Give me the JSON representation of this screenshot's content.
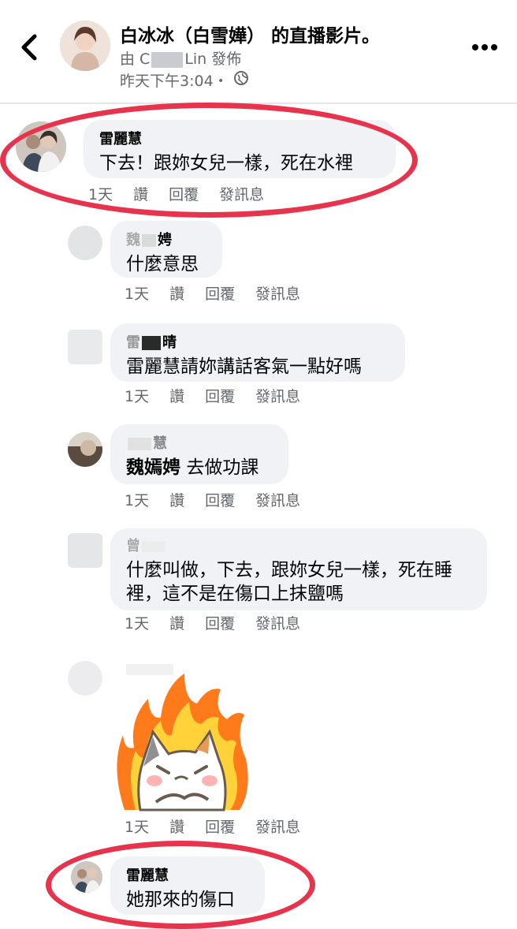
{
  "header": {
    "back_icon": "chevron-left-icon",
    "title": "白冰冰（白雪嬅） 的直播影片。",
    "by_prefix": "由 C",
    "by_suffix": "Lin 發佈",
    "time": "昨天下午3:04・",
    "privacy_icon": "globe-icon",
    "more_icon": "more-horizontal-icon"
  },
  "comments": [
    {
      "name": "雷麗慧",
      "text": "下去！跟妳女兒一樣，死在水裡",
      "time": "1天",
      "like": "讚",
      "reply": "回覆",
      "message": "發訊息"
    },
    {
      "name_visible": "魏",
      "name_suffix": "娉",
      "text": "什麼意思",
      "time": "1天",
      "like": "讚",
      "reply": "回覆",
      "message": "發訊息"
    },
    {
      "name_visible": "雷",
      "name_suffix": "晴",
      "text": "雷麗慧請妳講話客氣一點好嗎",
      "time": "1天",
      "like": "讚",
      "reply": "回覆",
      "message": "發訊息"
    },
    {
      "name_suffix": "慧",
      "mention": "魏嫣娉",
      "text": "去做功課",
      "time": "1天",
      "like": "讚",
      "reply": "回覆",
      "message": "發訊息"
    },
    {
      "name_visible": "曾",
      "text": "什麼叫做，下去，跟妳女兒一樣，死在睡裡，這不是在傷口上抹鹽嗎",
      "time": "1天",
      "like": "讚",
      "reply": "回覆",
      "message": "發訊息"
    },
    {
      "sticker": "angry-cat-sticker",
      "time": "1天",
      "like": "讚",
      "reply": "回覆",
      "message": "發訊息"
    },
    {
      "name": "雷麗慧",
      "text": "她那來的傷口"
    }
  ],
  "colors": {
    "highlight_oval": "#e8334d",
    "bubble": "#f0f2f5",
    "meta_text": "#65676b"
  }
}
